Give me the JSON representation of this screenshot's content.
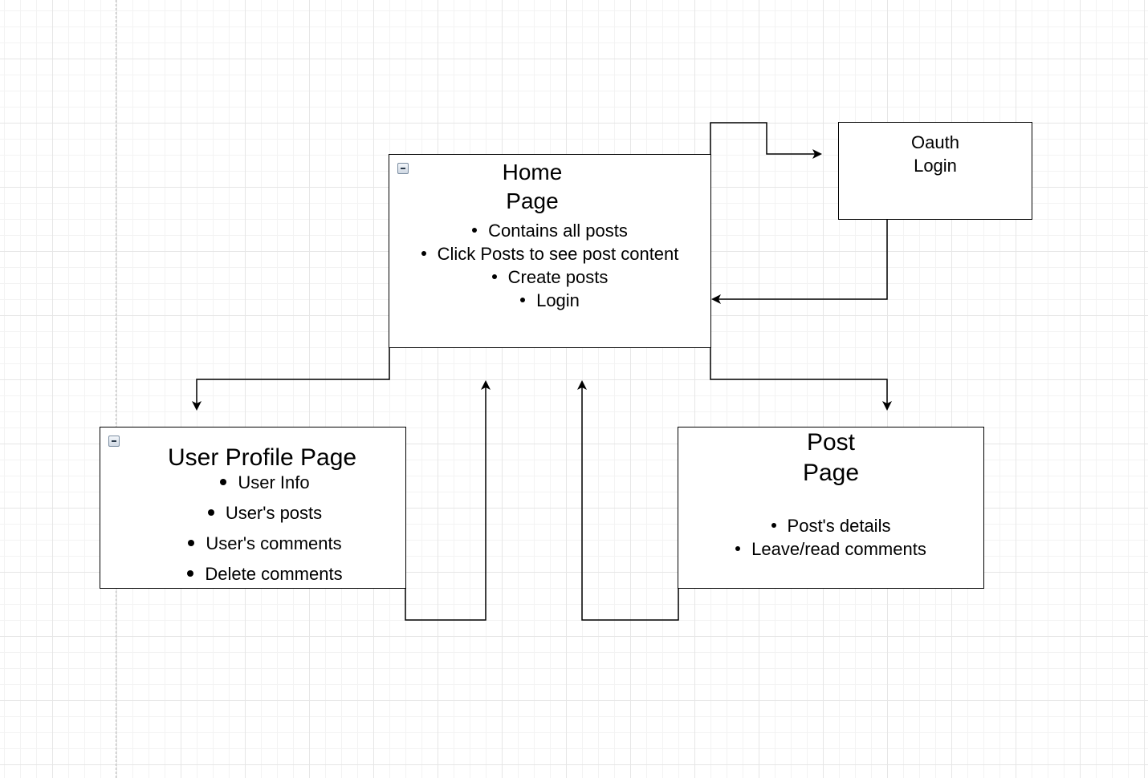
{
  "nodes": {
    "home": {
      "title_line1": "Home",
      "title_line2": "Page",
      "items": [
        "Contains all posts",
        "Click Posts to see post content",
        "Create posts",
        "Login"
      ]
    },
    "oauth": {
      "title_line1": "Oauth",
      "title_line2": "Login"
    },
    "profile": {
      "title": "User Profile Page",
      "items": [
        "User Info",
        "User's posts",
        "User's comments",
        "Delete comments"
      ]
    },
    "post": {
      "title_line1": "Post",
      "title_line2": "Page",
      "items": [
        "Post's details",
        "Leave/read comments"
      ]
    }
  },
  "edges": [
    {
      "from": "home",
      "to": "oauth"
    },
    {
      "from": "oauth",
      "to": "home"
    },
    {
      "from": "home",
      "to": "profile"
    },
    {
      "from": "home",
      "to": "post"
    },
    {
      "from": "profile",
      "to": "home"
    },
    {
      "from": "post",
      "to": "home"
    }
  ],
  "colors": {
    "grid_major": "#e6e6e6",
    "grid_minor": "#f3f3f3",
    "stroke": "#000000",
    "collapse_icon": "#7a8ca0"
  }
}
